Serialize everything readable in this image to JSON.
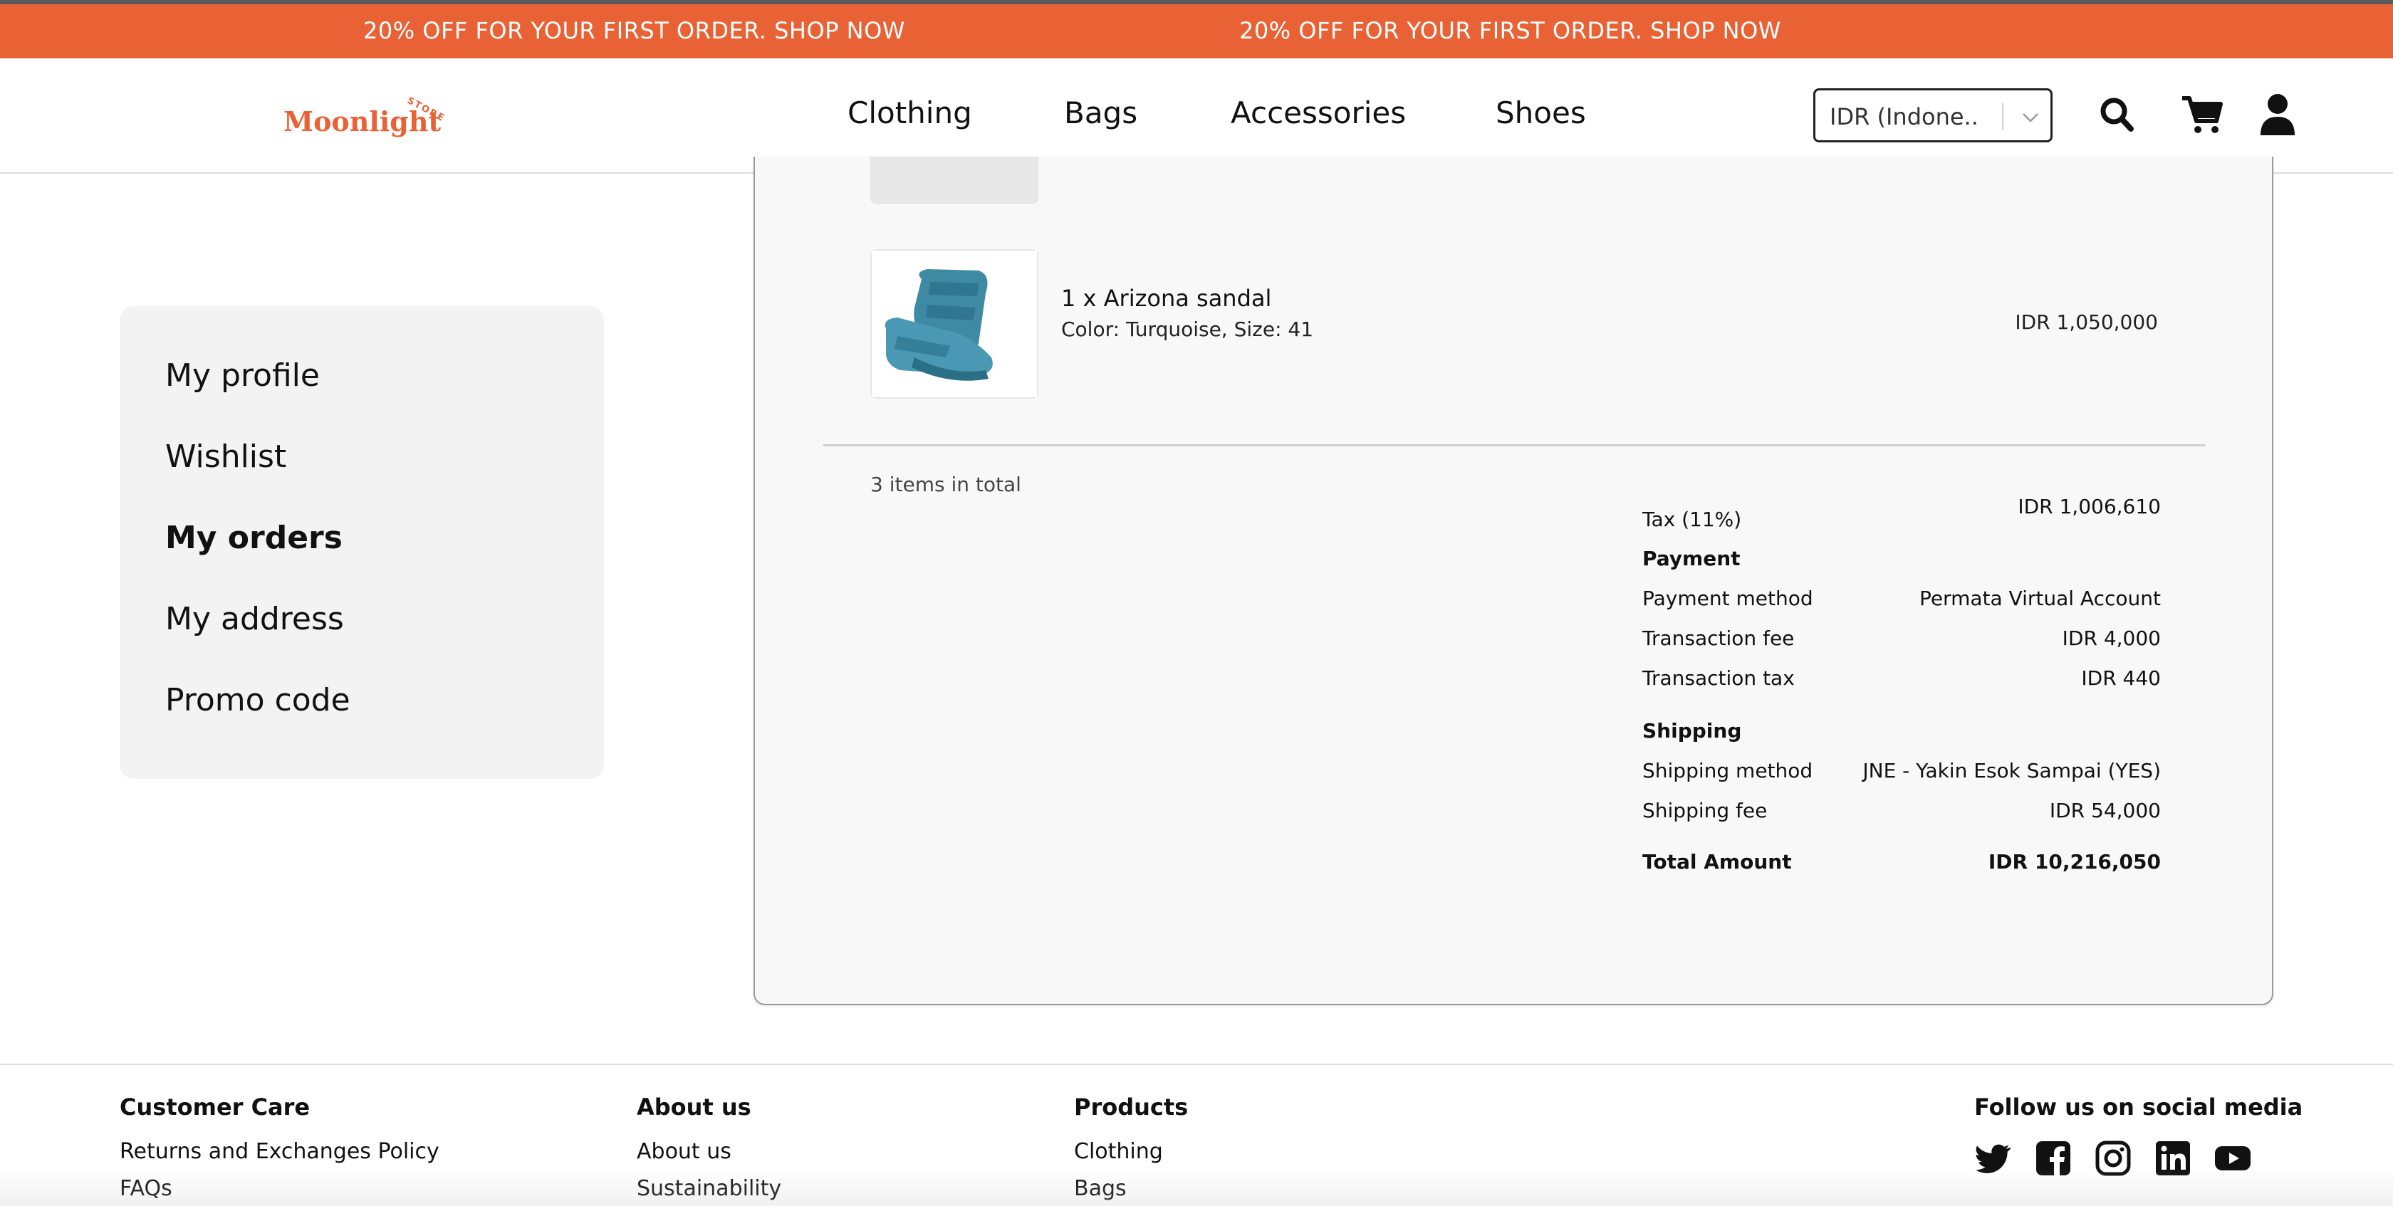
{
  "promo": {
    "text_1": "20% OFF FOR YOUR FIRST ORDER. SHOP NOW",
    "text_2": "20% OFF FOR YOUR FIRST ORDER. SHOP NOW"
  },
  "brand": {
    "name": "Moonlight",
    "tagline": "STORE",
    "accent_color": "#E86235"
  },
  "nav": {
    "items": [
      {
        "label": "Clothing"
      },
      {
        "label": "Bags"
      },
      {
        "label": "Accessories"
      },
      {
        "label": "Shoes"
      }
    ]
  },
  "currency": {
    "selected": "IDR (Indone..."
  },
  "header_icons": [
    "search-icon",
    "cart-icon",
    "user-icon"
  ],
  "sidebar": {
    "items": [
      {
        "label": "My profile"
      },
      {
        "label": "Wishlist"
      },
      {
        "label": "My orders",
        "active": true
      },
      {
        "label": "My address"
      },
      {
        "label": "Promo code"
      }
    ]
  },
  "order": {
    "item": {
      "name": "1 x Arizona sandal",
      "meta": "Color: Turquoise, Size: 41",
      "price": "IDR 1,050,000"
    },
    "items_total": "3 items in total",
    "tax": {
      "label": "Tax (11%)",
      "value": "IDR 1,006,610"
    },
    "payment": {
      "heading": "Payment",
      "method_label": "Payment method",
      "method_value": "Permata Virtual Account",
      "fee_label": "Transaction fee",
      "fee_value": "IDR 4,000",
      "tax_label": "Transaction tax",
      "tax_value": "IDR 440"
    },
    "shipping": {
      "heading": "Shipping",
      "method_label": "Shipping method",
      "method_value": "JNE - Yakin Esok Sampai (YES)",
      "fee_label": "Shipping fee",
      "fee_value": "IDR 54,000"
    },
    "total": {
      "label": "Total Amount",
      "value": "IDR 10,216,050"
    }
  },
  "footer": {
    "customer_care": {
      "heading": "Customer Care",
      "links": [
        "Returns and Exchanges Policy",
        "FAQs"
      ]
    },
    "about": {
      "heading": "About us",
      "links": [
        "About us",
        "Sustainability"
      ]
    },
    "products": {
      "heading": "Products",
      "links": [
        "Clothing",
        "Bags"
      ]
    },
    "social": {
      "heading": "Follow us on social media",
      "icons": [
        "twitter-icon",
        "facebook-icon",
        "instagram-icon",
        "linkedin-icon",
        "youtube-icon"
      ]
    }
  }
}
